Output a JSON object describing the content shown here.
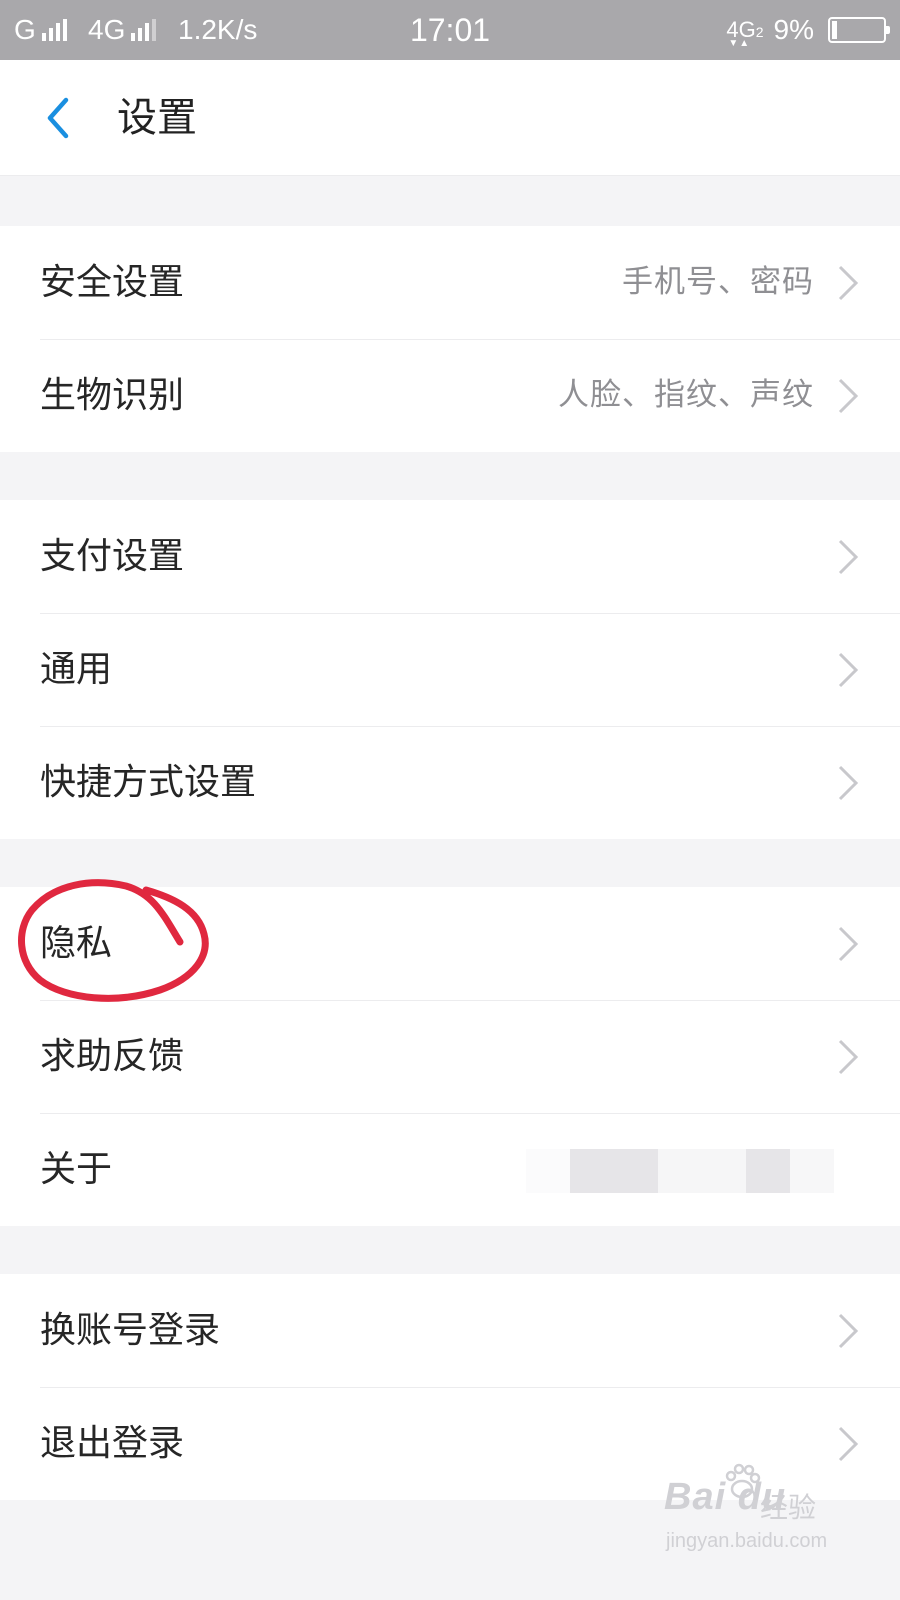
{
  "status_bar": {
    "carrier1": "G",
    "carrier2": "4G",
    "net_speed": "1.2K/s",
    "time": "17:01",
    "network2": "4G",
    "network2_sub": "2",
    "battery_percent": "9%",
    "battery_level": 0.09,
    "icons": [
      "signal-icon",
      "signal-icon",
      "network-4g-icon",
      "battery-icon"
    ]
  },
  "header": {
    "back_icon": "chevron-left-icon",
    "title": "设置",
    "accent_color": "#1a8fe0"
  },
  "groups": [
    {
      "items": [
        {
          "label": "安全设置",
          "value": "手机号、密码"
        },
        {
          "label": "生物识别",
          "value": "人脸、指纹、声纹"
        }
      ]
    },
    {
      "items": [
        {
          "label": "支付设置"
        },
        {
          "label": "通用"
        },
        {
          "label": "快捷方式设置"
        }
      ]
    },
    {
      "items": [
        {
          "label": "隐私",
          "annotated": true
        },
        {
          "label": "求助反馈"
        },
        {
          "label": "关于"
        }
      ]
    },
    {
      "items": [
        {
          "label": "换账号登录"
        },
        {
          "label": "退出登录"
        }
      ]
    }
  ],
  "annotation": {
    "color": "#e0283f",
    "target": "隐私"
  },
  "watermark": {
    "logo": "Bai du",
    "sub": "经验",
    "url": "jingyan.baidu.com"
  }
}
